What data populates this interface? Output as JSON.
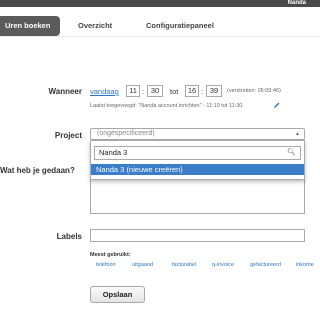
{
  "app": {
    "brand": "Nanda"
  },
  "tabs": [
    {
      "label": "Uren boeken",
      "active": true
    },
    {
      "label": "Overzicht"
    },
    {
      "label": "Configuratiepaneel"
    }
  ],
  "when": {
    "label": "Wanneer",
    "day_link": "vandaag",
    "start_h": "11",
    "start_m": "30",
    "to": "tot",
    "end_h": "16",
    "end_m": "39",
    "elapsed": "(verstreken: 05:09:46)",
    "last_added": "Laatst toegevoegd: \"Nanda account inrichten\" - 11:10 tot 11:30."
  },
  "project": {
    "label": "Project",
    "select_value": "(ongespecificeerd)",
    "search_value": "Nanda 3",
    "option": "Nanda 3 (nieuwe creëren)"
  },
  "done": {
    "label": "Wat heb je gedaan?"
  },
  "labels": {
    "label": "Labels",
    "most_used_label": "Meest gebruikt:",
    "tags": [
      "telefoon",
      "uitgaand",
      "facturabel",
      "q-invoice",
      "gefactureerd",
      "inkome"
    ]
  },
  "save_label": "Opslaan",
  "colors": {
    "accent": "#2c78c8",
    "selection": "#3a7dc9",
    "topbar": "#4a4a4a"
  }
}
